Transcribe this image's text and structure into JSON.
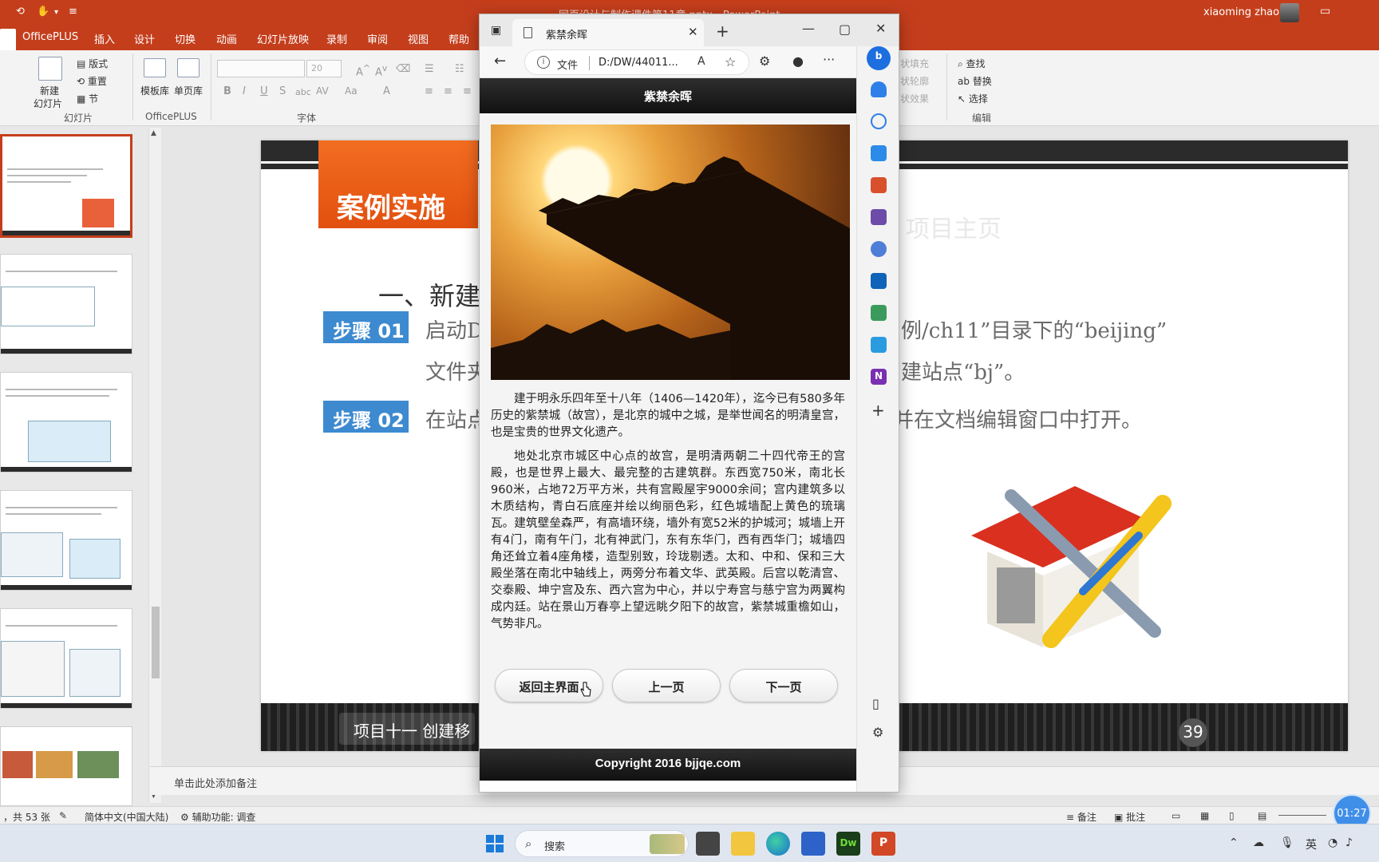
{
  "ppt": {
    "doc_title": "网页设计与制作课件第11章.pptx  -  PowerPoint",
    "user_name": "xiaoming zhao",
    "tabs": [
      "OfficePLUS",
      "插入",
      "设计",
      "切换",
      "动画",
      "幻灯片放映",
      "录制",
      "审阅",
      "视图",
      "帮助"
    ],
    "ribbon": {
      "new_slide": "新建",
      "new_slide_2": "幻灯片",
      "layout": "版式",
      "reset": "重置",
      "section": "节",
      "group_slides": "幻灯片",
      "template_lib": "模板库",
      "single_page_lib": "单页库",
      "group_officeplus": "OfficePLUS",
      "font_size": "20",
      "group_font": "字体",
      "shape_fill": "状填充",
      "shape_outline": "状轮廓",
      "shape_effect": "状效果",
      "find": "查找",
      "replace": "替换",
      "select": "选择",
      "group_edit": "编辑"
    },
    "slide": {
      "badge_title": "案例实施",
      "ghost_heading": "项目主页",
      "section_title": "一、新建",
      "step1_badge": "步骤 01",
      "step1_text_left": "启动D",
      "step1_text_right": "例/ch11”目录下的“beijing”",
      "step1_line2_left": "文件夹",
      "step1_line2_right": "建站点“bj”。",
      "step2_badge": "步骤 02",
      "step2_text_left": "在站点",
      "step2_text_right": "并在文档编辑窗口中打开。",
      "footer_label": "项目十一  创建移",
      "number": "39"
    },
    "notes_placeholder": "单击此处添加备注",
    "status": {
      "slide_count": "，共 53 张",
      "language": "简体中文(中国大陆)",
      "accessibility": "辅助功能: 调查",
      "notes": "备注",
      "comments": "批注"
    },
    "clock": "01:27"
  },
  "browser": {
    "tab_title": "紫禁余晖",
    "address_scheme": "文件",
    "address_url": "D:/DW/44011...",
    "page": {
      "header": "紫禁余晖",
      "para1": "建于明永乐四年至十八年（1406—1420年），迄今已有580多年历史的紫禁城（故宫），是北京的城中之城，是举世闻名的明清皇宫，也是宝贵的世界文化遗产。",
      "para2": "地处北京市城区中心点的故宫，是明清两朝二十四代帝王的宫殿，也是世界上最大、最完整的古建筑群。东西宽750米，南北长960米，占地72万平方米，共有宫殿屋宇9000余间；宫内建筑多以木质结构，青白石底座并绘以绚丽色彩，红色城墙配上黄色的琉璃瓦。建筑壁垒森严，有高墙环绕，墙外有宽52米的护城河；城墙上开有4门，南有午门，北有神武门，东有东华门，西有西华门；城墙四角还耸立着4座角楼，造型别致，玲珑剔透。太和、中和、保和三大殿坐落在南北中轴线上，两旁分布着文华、武英殿。后宫以乾清宫、交泰殿、坤宁宫及东、西六宫为中心，并以宁寿宫与慈宁宫为两翼构成内廷。站在景山万春亭上望远眺夕阳下的故宫，紫禁城重檐如山，气势非凡。",
      "buttons": [
        "返回主界面",
        "上一页",
        "下一页"
      ],
      "footer": "Copyright 2016 bjjqe.com"
    }
  },
  "taskbar": {
    "search_placeholder": "搜索",
    "ime": "英"
  },
  "colors": {
    "ppt_accent": "#c43e1c",
    "slide_orange": "#f26d21",
    "step_blue": "#3d8ad0",
    "edge_blue": "#1c7ad8"
  }
}
